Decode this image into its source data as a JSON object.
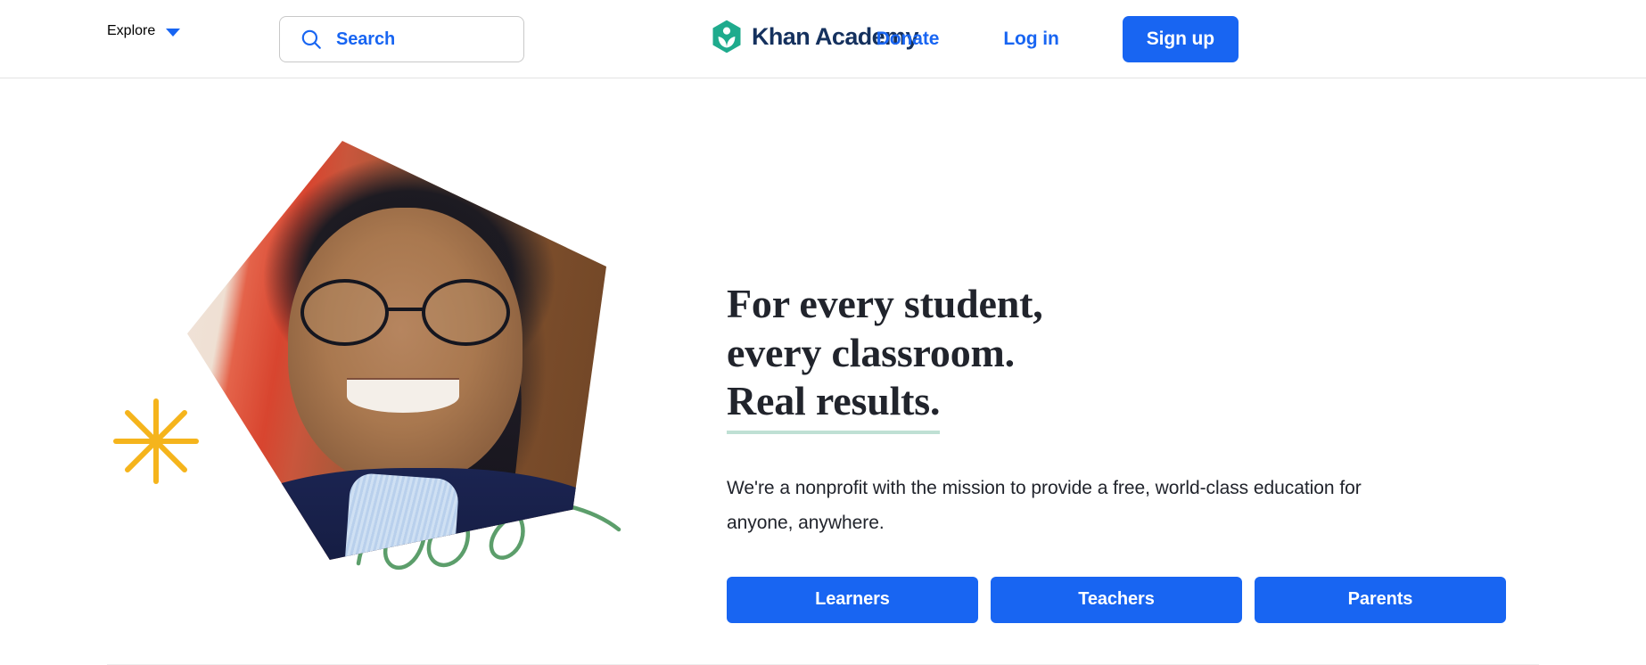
{
  "header": {
    "explore_label": "Explore",
    "explore_caret_icon": "chevron-down-icon",
    "search": {
      "icon": "search-icon",
      "placeholder": "Search",
      "value": ""
    },
    "logo": {
      "icon": "khan-academy-leaf-hexagon-icon",
      "text": "Khan Academy",
      "mark_color": "#1fab8d",
      "text_color": "#15315e"
    },
    "donate_label": "Donate",
    "login_label": "Log in",
    "signup_label": "Sign up"
  },
  "hero": {
    "headline_line1": "For every student,",
    "headline_line2": "every classroom.",
    "headline_line3": "Real results.",
    "headline_underline_color": "#bfe0d4",
    "subhead_line1": "We're a nonprofit with the mission to provide a free, world-class education",
    "subhead_line2": "for anyone, anywhere.",
    "cta_buttons": [
      {
        "label": "Learners"
      },
      {
        "label": "Teachers"
      },
      {
        "label": "Parents"
      }
    ],
    "photo": {
      "alt": "Smiling student wearing glasses and a navy blazer",
      "shape": "pentagon"
    },
    "decorations": [
      {
        "name": "starburst-doodle",
        "color": "#f5b41c"
      },
      {
        "name": "square-outline-doodle",
        "color": "#e8703a"
      },
      {
        "name": "loops-squiggle-doodle",
        "color": "#5c9e6b"
      }
    ]
  },
  "colors": {
    "brand_blue": "#1865f2",
    "brand_green": "#1fab8d",
    "navy": "#15315e",
    "text": "#21242c"
  }
}
